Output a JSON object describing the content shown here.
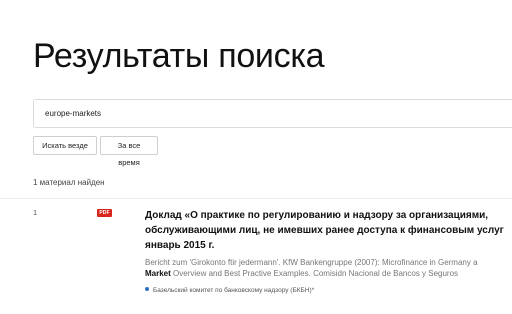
{
  "header": {
    "title": "Результаты поиска"
  },
  "search": {
    "value": "europe-markets"
  },
  "filters": {
    "scope_label": "Искать везде",
    "time_label": "За все время"
  },
  "results_summary": {
    "count_text": "1 материал найден"
  },
  "results": [
    {
      "index": "1",
      "type_badge": "PDF",
      "title_lines": [
        "Доклад «О практике по регулированию и надзору за организациями,",
        "обслуживающими лиц, не имевших ранее доступа к финансовым услуг",
        "январь 2015 г."
      ],
      "snippet_line1": "Bericht zum 'Girokonto ftir jedermann'. KfW Bankengruppe (2007): Microfinance in Germany a",
      "snippet_line2_highlight": "Market",
      "snippet_line2_rest": " Overview and Best Practive Examples. Comisidn Nacional de Bancos y Seguros",
      "source": "Базельский комитет по банковскому надзору (БКБН)*"
    }
  ]
}
